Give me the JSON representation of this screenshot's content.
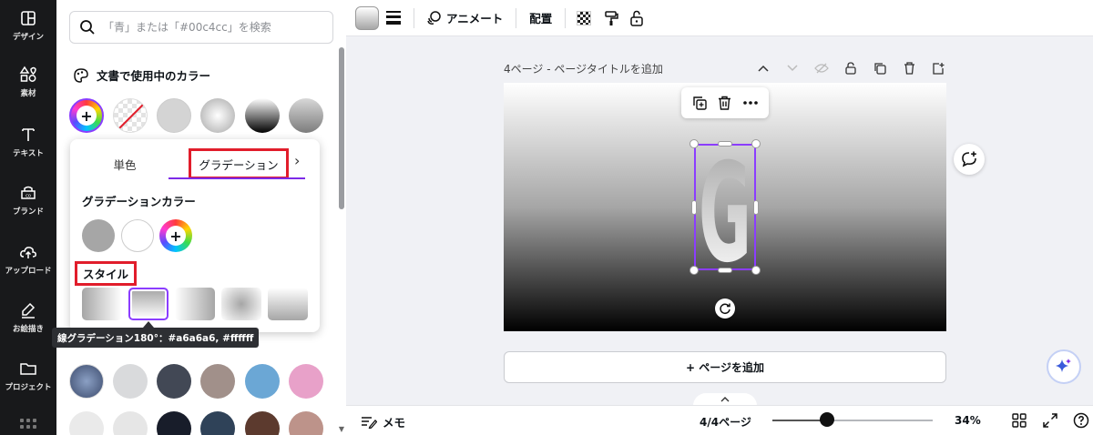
{
  "rail": {
    "items": [
      {
        "label": "デザイン",
        "icon": "layout-icon"
      },
      {
        "label": "素材",
        "icon": "shapes-icon"
      },
      {
        "label": "テキスト",
        "icon": "text-icon"
      },
      {
        "label": "ブランド",
        "icon": "brand-icon"
      },
      {
        "label": "アップロード",
        "icon": "upload-icon"
      },
      {
        "label": "お絵描き",
        "icon": "draw-icon"
      },
      {
        "label": "プロジェクト",
        "icon": "folder-icon"
      }
    ]
  },
  "panel": {
    "search_placeholder": "「青」または「#00c4cc」を検索",
    "document_colors_title": "文書で使用中のカラー"
  },
  "popover": {
    "tabs": {
      "solid": "単色",
      "gradient": "グラデーション"
    },
    "gradient_colors_title": "グラデーションカラー",
    "gradient_colors": [
      "#a6a6a6",
      "#ffffff"
    ],
    "style_label": "スタイル",
    "tooltip": "線グラデーション180°：#a6a6a6, #ffffff"
  },
  "toolbar": {
    "animate": "アニメート",
    "arrange": "配置"
  },
  "page": {
    "title": "4ページ - ページタイトルを追加",
    "add_page": "+ ページを追加",
    "glyph": "G"
  },
  "bottom": {
    "memo": "メモ",
    "page_count": "4/4ページ",
    "zoom": "34%",
    "zoom_fraction": 0.34
  },
  "colors": {
    "accent": "#7d2ae8",
    "highlight": "#e11d2b"
  }
}
